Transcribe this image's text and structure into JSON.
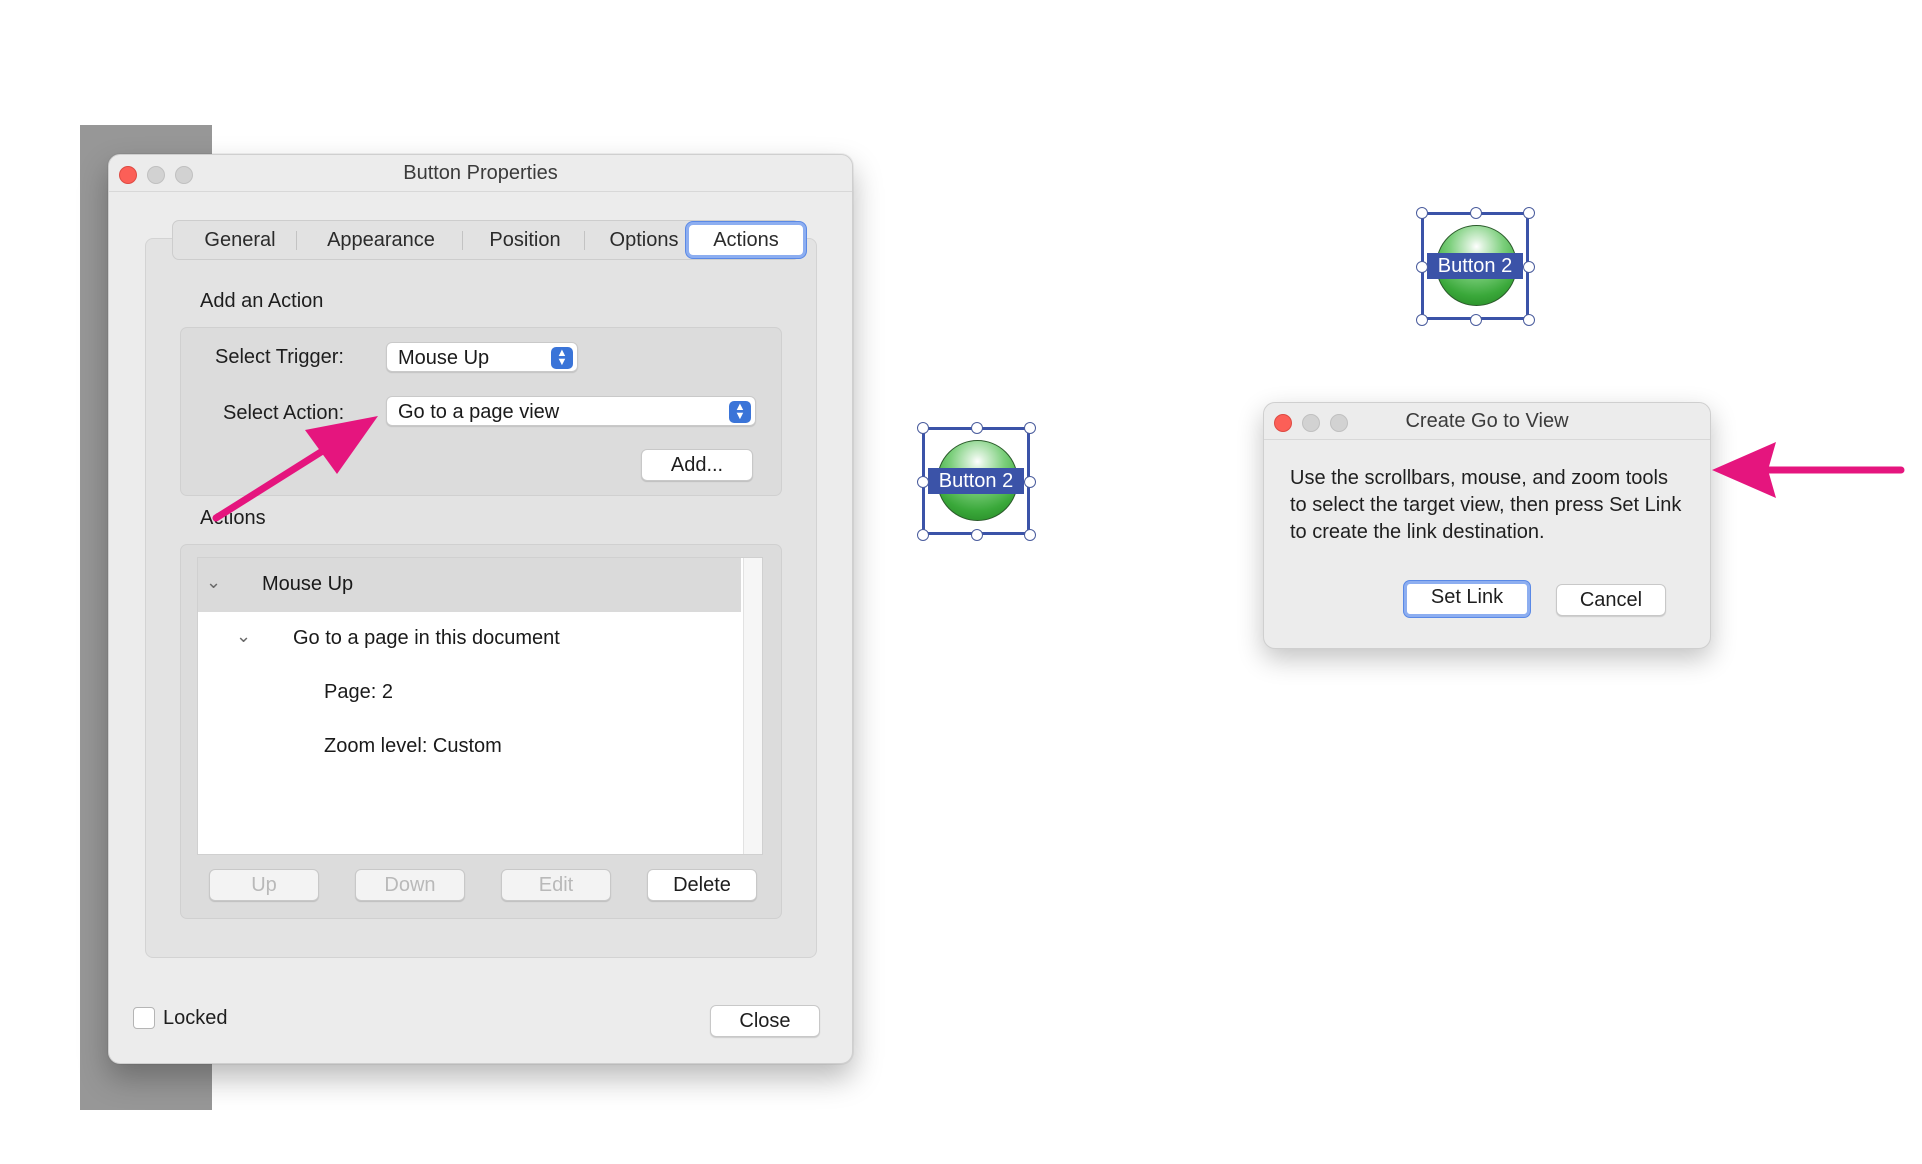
{
  "colors": {
    "annotation_arrow": "#e5157e",
    "selection_frame": "#3b53a8",
    "accent": "#3a74d8"
  },
  "button_properties": {
    "title": "Button Properties",
    "tabs": [
      "General",
      "Appearance",
      "Position",
      "Options",
      "Actions"
    ],
    "active_tab": "Actions",
    "add_action": {
      "heading": "Add an Action",
      "trigger_label": "Select Trigger:",
      "trigger_value": "Mouse Up",
      "action_label": "Select Action:",
      "action_value": "Go to a page view",
      "add_button": "Add..."
    },
    "actions": {
      "heading": "Actions",
      "tree": {
        "trigger": "Mouse Up",
        "action": "Go to a page in this document",
        "details": [
          "Page: 2",
          "Zoom level: Custom"
        ]
      },
      "buttons": {
        "up": "Up",
        "down": "Down",
        "edit": "Edit",
        "delete": "Delete"
      }
    },
    "locked_label": "Locked",
    "locked_checked": false,
    "close_button": "Close"
  },
  "form_buttons": {
    "left_label": "Button 2",
    "right_label": "Button 2"
  },
  "goto_view": {
    "title": "Create Go to View",
    "message": "Use the scrollbars, mouse, and zoom tools to select the target view, then press Set Link to create the link destination.",
    "set_link_button": "Set Link",
    "cancel_button": "Cancel"
  },
  "icons": {
    "dropdown": "up-down-stepper-icon",
    "disclosure": "chevron-down-icon",
    "annotation": "arrow-icon"
  }
}
